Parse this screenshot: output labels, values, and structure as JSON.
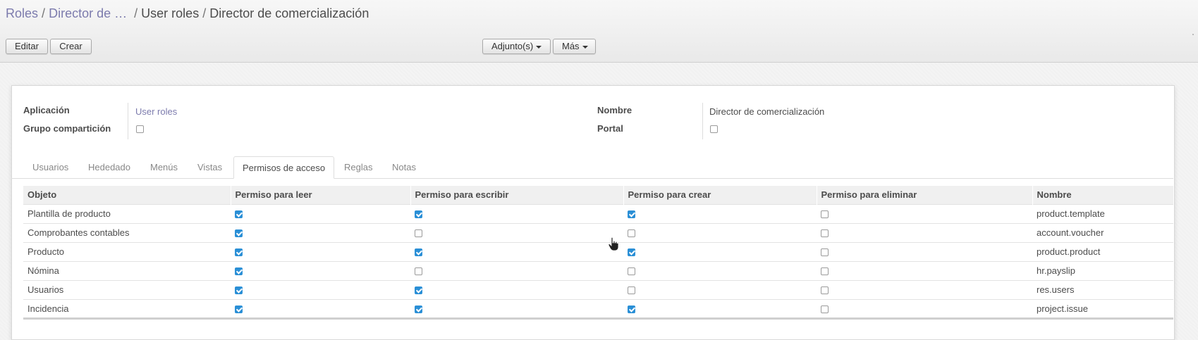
{
  "breadcrumb": {
    "items": [
      "Roles",
      "Director de …",
      "User roles",
      "Director de comercialización"
    ],
    "separator": "/"
  },
  "toolbar": {
    "edit_label": "Editar",
    "create_label": "Crear",
    "attachments_label": "Adjunto(s)",
    "more_label": "Más"
  },
  "form": {
    "aplicacion_label": "Aplicación",
    "aplicacion_value": "User roles",
    "grupo_label": "Grupo compartición",
    "grupo_checked": false,
    "nombre_label": "Nombre",
    "nombre_value": "Director de comercialización",
    "portal_label": "Portal",
    "portal_checked": false
  },
  "tabs": [
    {
      "label": "Usuarios",
      "active": false
    },
    {
      "label": "Hededado",
      "active": false
    },
    {
      "label": "Menús",
      "active": false
    },
    {
      "label": "Vistas",
      "active": false
    },
    {
      "label": "Permisos de acceso",
      "active": true
    },
    {
      "label": "Reglas",
      "active": false
    },
    {
      "label": "Notas",
      "active": false
    }
  ],
  "table": {
    "columns": [
      "Objeto",
      "Permiso para leer",
      "Permiso para escribir",
      "Permiso para crear",
      "Permiso para eliminar",
      "Nombre"
    ],
    "rows": [
      {
        "objeto": "Plantilla de producto",
        "read": true,
        "write": true,
        "create": true,
        "unlink": false,
        "nombre": "product.template"
      },
      {
        "objeto": "Comprobantes contables",
        "read": true,
        "write": false,
        "create": false,
        "unlink": false,
        "nombre": "account.voucher"
      },
      {
        "objeto": "Producto",
        "read": true,
        "write": true,
        "create": true,
        "unlink": false,
        "nombre": "product.product"
      },
      {
        "objeto": "Nómina",
        "read": true,
        "write": false,
        "create": false,
        "unlink": false,
        "nombre": "hr.payslip"
      },
      {
        "objeto": "Usuarios",
        "read": true,
        "write": true,
        "create": false,
        "unlink": false,
        "nombre": "res.users"
      },
      {
        "objeto": "Incidencia",
        "read": true,
        "write": true,
        "create": true,
        "unlink": false,
        "nombre": "project.issue"
      }
    ]
  },
  "colors": {
    "link": "#7c7bad",
    "checkbox_checked": "#2a8fd6",
    "text": "#4c4c4c"
  }
}
